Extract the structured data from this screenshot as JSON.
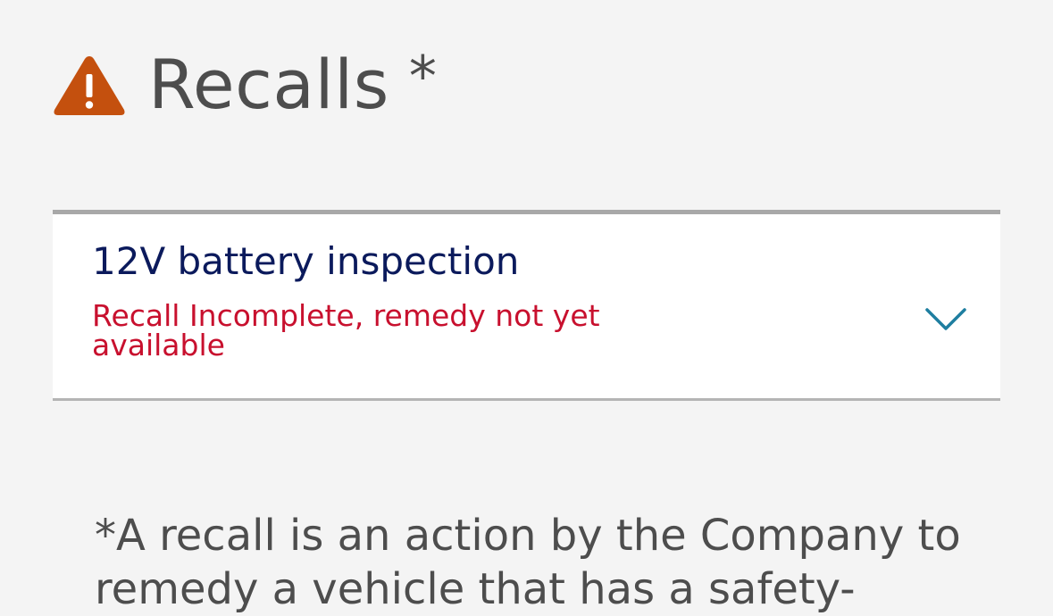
{
  "header": {
    "title": "Recalls",
    "asterisk": "*",
    "icon": "warning-triangle-icon",
    "icon_color": "#c4500e"
  },
  "recalls": [
    {
      "name": "12V battery inspection",
      "status": "Recall Incomplete, remedy not yet available",
      "status_color": "#c8102e",
      "expand_icon": "chevron-down-icon"
    }
  ],
  "footnote": {
    "text": "*A recall is an action by the Company to remedy a vehicle that has a safety-"
  },
  "colors": {
    "background": "#f4f4f4",
    "card": "#ffffff",
    "title_text": "#4d4d4d",
    "recall_name": "#0b1a5c",
    "chevron": "#1e7ea0"
  }
}
